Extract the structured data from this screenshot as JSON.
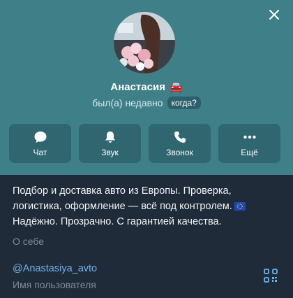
{
  "profile": {
    "name": "Анастасия",
    "name_emoji": "🚘",
    "last_seen": "был(а) недавно",
    "when_button": "когда?"
  },
  "actions": [
    {
      "label": "Чат",
      "icon": "chat-icon"
    },
    {
      "label": "Звук",
      "icon": "bell-icon"
    },
    {
      "label": "Звонок",
      "icon": "phone-icon"
    },
    {
      "label": "Ещё",
      "icon": "more-icon"
    }
  ],
  "bio": {
    "lines": [
      "Подбор и доставка авто из Европы. Проверка,",
      "логистика, оформление — всё под контролем.",
      "Надёжно. Прозрачно. С гарантией качества."
    ],
    "flag_icon": "eu-flag-icon",
    "caption": "О себе"
  },
  "username": {
    "value": "@Anastasiya_avto",
    "caption": "Имя пользователя"
  },
  "colors": {
    "header": "#3e7f88",
    "button": "#2f6670",
    "background": "#1f2b38",
    "link": "#6fb3ec",
    "muted": "#7d8b98"
  }
}
